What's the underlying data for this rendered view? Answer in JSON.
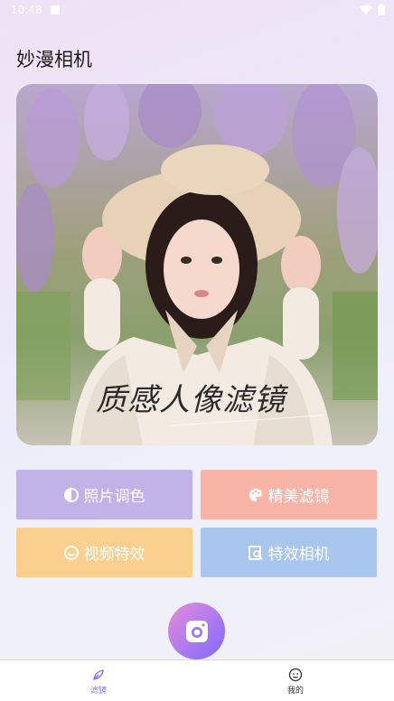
{
  "status_bar": {
    "time": "10:48"
  },
  "app": {
    "title": "妙漫相机"
  },
  "hero": {
    "caption": "质感人像滤镜"
  },
  "actions": [
    {
      "label": "照片调色",
      "icon": "contrast-icon",
      "color": "#c1b2e8"
    },
    {
      "label": "精美滤镜",
      "icon": "palette-icon",
      "color": "#f8b4a7"
    },
    {
      "label": "视频特效",
      "icon": "smile-icon",
      "color": "#fbcf8e"
    },
    {
      "label": "特效相机",
      "icon": "image-search-icon",
      "color": "#a9c6ee"
    }
  ],
  "camera": {
    "icon": "camera-icon"
  },
  "nav": {
    "items": [
      {
        "label": "滤镜",
        "icon": "feather-icon",
        "active": true
      },
      {
        "label": "我的",
        "icon": "face-icon",
        "active": false
      }
    ],
    "active_color": "#8a6fe8",
    "inactive_color": "#333333"
  }
}
